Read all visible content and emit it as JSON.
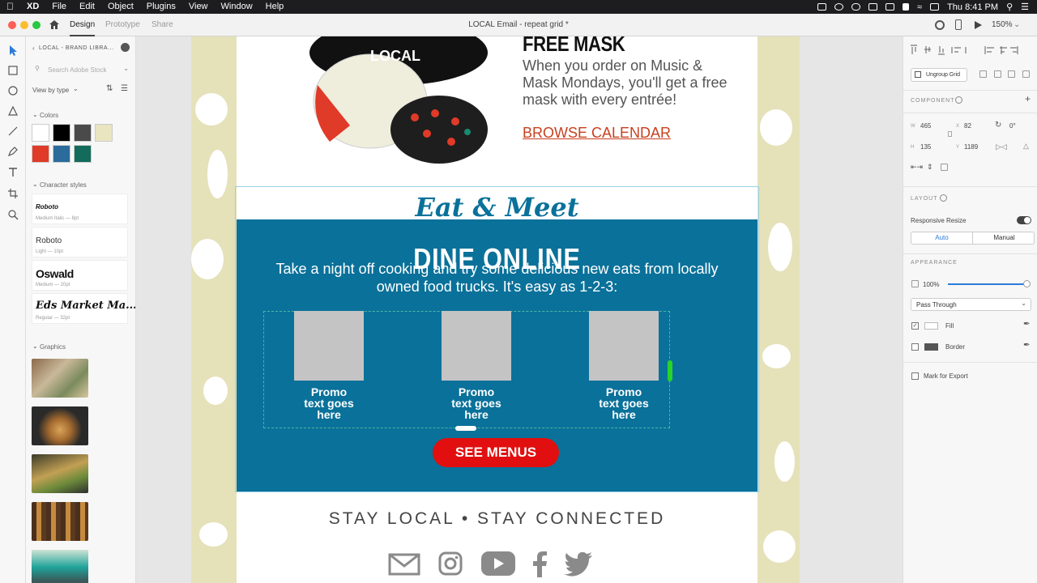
{
  "menubar": {
    "apple_icon": "apple-icon",
    "app_name": "XD",
    "items": [
      "File",
      "Edit",
      "Object",
      "Plugins",
      "View",
      "Window",
      "Help"
    ],
    "clock": "Thu 8:41 PM"
  },
  "titlebar": {
    "tabs": [
      "Design",
      "Prototype",
      "Share"
    ],
    "active_tab": "Design",
    "document_title": "LOCAL Email - repeat grid *",
    "zoom": "150%"
  },
  "library": {
    "title": "LOCAL - BRAND LIBRA...",
    "search_placeholder": "Search Adobe Stock",
    "view_by": "View by type",
    "colors_label": "Colors",
    "colors": [
      "#ffffff",
      "#000000",
      "#4a4a4a",
      "#e8e5c0",
      "#e03a28",
      "#2b6c9c",
      "#136b5b"
    ],
    "char_styles_label": "Character styles",
    "char_styles": [
      {
        "name": "Roboto",
        "desc": "Medium Italic — 8pt"
      },
      {
        "name": "Roboto",
        "desc": "Light — 10pt"
      },
      {
        "name": "Oswald",
        "desc": "Medium — 20pt"
      },
      {
        "name": "Eds Market Ma...",
        "desc": "Regular — 32pt"
      }
    ],
    "graphics_label": "Graphics"
  },
  "email": {
    "mask_heading": "FREE MASK",
    "mask_body": "When you order on Music & Mask Mondays, you'll get a free mask with every entrée!",
    "mask_link": "BROWSE CALENDAR",
    "script_heading": "Eat & Meet",
    "dine_heading": "DINE ONLINE",
    "dine_body": "Take a night off cooking and try some delicious new eats from locally owned food trucks. It's easy as 1-2-3:",
    "promos": [
      "Promo\ntext goes\nhere",
      "Promo\ntext goes\nhere",
      "Promo\ntext goes\nhere"
    ],
    "cta": "SEE MENUS",
    "footer_tagline": "STAY LOCAL • STAY CONNECTED",
    "social_icons": [
      "mail-icon",
      "instagram-icon",
      "youtube-icon",
      "facebook-icon",
      "twitter-icon"
    ]
  },
  "inspector": {
    "ungroup": "Ungroup Grid",
    "component_label": "COMPONENT",
    "w_label": "W",
    "w": "465",
    "x_label": "X",
    "x": "82",
    "rotation": "0°",
    "h_label": "H",
    "h": "135",
    "y_label": "Y",
    "y": "1189",
    "layout_label": "LAYOUT",
    "responsive_resize": "Responsive Resize",
    "auto": "Auto",
    "manual": "Manual",
    "appearance_label": "APPEARANCE",
    "opacity": "100%",
    "opacity_level": 1.0,
    "blend_mode": "Pass Through",
    "fill_label": "Fill",
    "border_label": "Border",
    "mark_export": "Mark for Export"
  },
  "colors": {
    "brand_red": "#e10f0f",
    "brand_blue": "#0a719a",
    "artboard_bg": "#e5e1b9",
    "link_red": "#c8401f"
  }
}
